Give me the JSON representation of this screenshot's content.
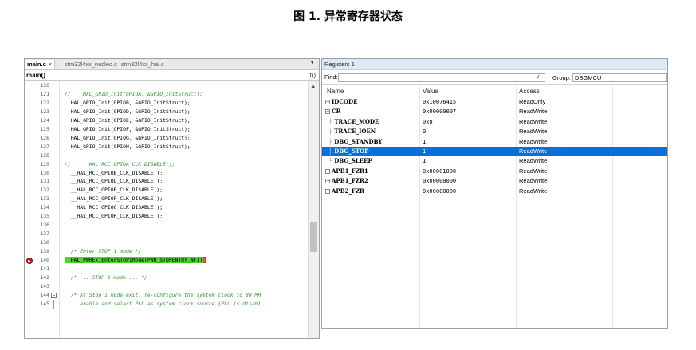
{
  "figure_title": "图 1. 异常寄存器状态",
  "editor": {
    "tabs": [
      {
        "label": "main.c",
        "active": true,
        "close": "×"
      },
      {
        "label": "stm32l4xx_nucleo.c",
        "active": false
      },
      {
        "label": "stm32l4xx_hal.c",
        "active": false
      }
    ],
    "tab_dropdown": "▼",
    "function": "main()",
    "function_icon": "f()",
    "lines": [
      {
        "n": "120",
        "text": ""
      },
      {
        "n": "121",
        "text": "//    HAL_GPIO_Init(GPIOA, &GPIO_InitStruct);",
        "comment": true
      },
      {
        "n": "122",
        "text": "  HAL_GPIO_Init(GPIOB, &GPIO_InitStruct);"
      },
      {
        "n": "123",
        "text": "  HAL_GPIO_Init(GPIOD, &GPIO_InitStruct);"
      },
      {
        "n": "124",
        "text": "  HAL_GPIO_Init(GPIOE, &GPIO_InitStruct);"
      },
      {
        "n": "125",
        "text": "  HAL_GPIO_Init(GPIOF, &GPIO_InitStruct);"
      },
      {
        "n": "126",
        "text": "  HAL_GPIO_Init(GPIOG, &GPIO_InitStruct);"
      },
      {
        "n": "127",
        "text": "  HAL_GPIO_Init(GPIOH, &GPIO_InitStruct);"
      },
      {
        "n": "128",
        "text": ""
      },
      {
        "n": "129",
        "text": "//    __HAL_RCC_GPIOA_CLK_DISABLE();",
        "comment": true
      },
      {
        "n": "130",
        "text": "  __HAL_RCC_GPIOB_CLK_DISABLE();"
      },
      {
        "n": "131",
        "text": "  __HAL_RCC_GPIOD_CLK_DISABLE();"
      },
      {
        "n": "132",
        "text": "  __HAL_RCC_GPIOE_CLK_DISABLE();"
      },
      {
        "n": "133",
        "text": "  __HAL_RCC_GPIOF_CLK_DISABLE();"
      },
      {
        "n": "134",
        "text": "  __HAL_RCC_GPIOG_CLK_DISABLE();"
      },
      {
        "n": "135",
        "text": "  __HAL_RCC_GPIOH_CLK_DISABLE();"
      },
      {
        "n": "136",
        "text": ""
      },
      {
        "n": "137",
        "text": ""
      },
      {
        "n": "138",
        "text": ""
      },
      {
        "n": "139",
        "text": "  /* Enter STOP 1 mode */",
        "comment": true
      },
      {
        "n": "140",
        "text": "  HAL_PWREx_EnterSTOP1Mode(PWR_STOPENTRY_WFI)",
        "highlight": true,
        "breakpoint": true,
        "cursor": ";"
      },
      {
        "n": "141",
        "text": ""
      },
      {
        "n": "142",
        "text": "  /* ... STOP 1 mode ... */",
        "comment": true
      },
      {
        "n": "143",
        "text": ""
      },
      {
        "n": "144",
        "text": "  /* At Stop 1 mode exit, re-configure the system clock to 80 MH",
        "comment": true,
        "fold": "−"
      },
      {
        "n": "145",
        "text": "     enable and select PLL as system clock source (PLL is disabl",
        "comment": true,
        "foldline": true
      }
    ]
  },
  "registers": {
    "title": "Registers 1",
    "find_label": "Find:",
    "find_value": "",
    "find_dropdown": "∨",
    "group_label": "Group:",
    "group_value": "DBGMCU",
    "headers": {
      "name": "Name",
      "value": "Value",
      "access": "Access"
    },
    "rows": [
      {
        "name": "IDCODE",
        "value": "0x10076415",
        "access": "ReadOnly",
        "expander": "+"
      },
      {
        "name": "CR",
        "value": "0x00000007",
        "access": "ReadWrite",
        "expander": "−"
      },
      {
        "name": "TRACE_MODE",
        "value": "0x0",
        "access": "ReadWrite",
        "tree": "├"
      },
      {
        "name": "TRACE_IOEN",
        "value": "0",
        "access": "ReadWrite",
        "tree": "├"
      },
      {
        "name": "DBG_STANDBY",
        "value": "1",
        "access": "ReadWrite",
        "tree": "├"
      },
      {
        "name": "DBG_STOP",
        "value": "1",
        "access": "ReadWrite",
        "tree": "├",
        "selected": true
      },
      {
        "name": "DBG_SLEEP",
        "value": "1",
        "access": "ReadWrite",
        "tree": "└"
      },
      {
        "name": "APB1_FZR1",
        "value": "0x00001800",
        "access": "ReadWrite",
        "expander": "+"
      },
      {
        "name": "APB1_FZR2",
        "value": "0x00000000",
        "access": "ReadWrite",
        "expander": "+"
      },
      {
        "name": "APB2_FZR",
        "value": "0x00000000",
        "access": "ReadWrite",
        "expander": "+"
      }
    ]
  },
  "colors": {
    "comment": "#2a9d2a",
    "highlight": "#4bd82a",
    "cursor": "#e83030",
    "selection": "#0a6fd6",
    "breakpoint": "#c82020"
  }
}
